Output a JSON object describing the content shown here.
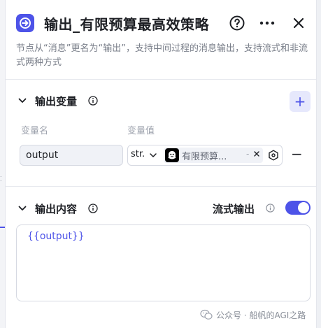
{
  "header": {
    "title": "输出_有限预算最高效策略",
    "help_icon": "question-circle-icon",
    "more_icon": "more-dots-icon",
    "close_icon": "close-icon"
  },
  "description": "节点从“消息”更名为“输出”，支持中间过程的消息输出，支持流式和非流式两种方式",
  "output_vars": {
    "title": "输出变量",
    "add_label": "+",
    "col_name": "变量名",
    "col_value": "变量值",
    "rows": [
      {
        "name": "output",
        "type": "str.",
        "ref_text": "有限预算...",
        "ref_sep": "-",
        "remove_label": "−"
      }
    ]
  },
  "output_content": {
    "title": "输出内容",
    "stream_label": "流式输出",
    "stream_enabled": true,
    "content": "{{output}}"
  },
  "watermark": {
    "text": "公众号 · 船帆的AGI之路"
  },
  "colors": {
    "accent": "#4d53e8",
    "accent_light": "#e6e8fc",
    "muted_text": "#7a7f8a"
  }
}
